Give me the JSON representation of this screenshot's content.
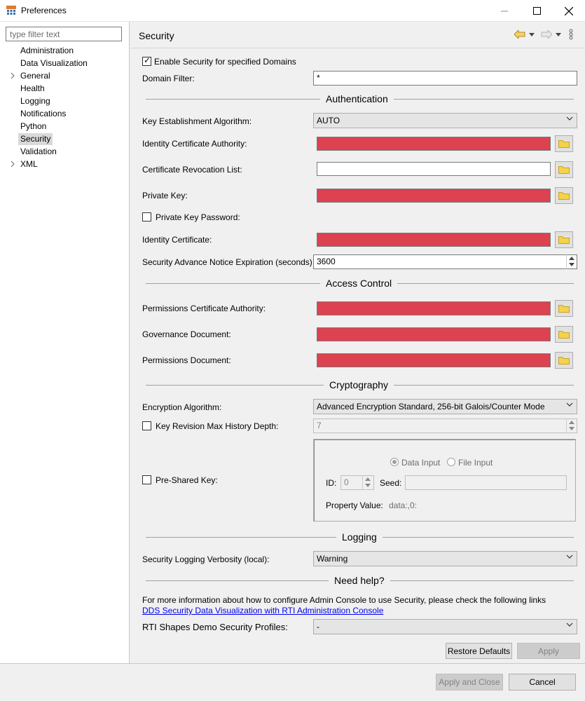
{
  "window": {
    "title": "Preferences",
    "minimize": "—",
    "maximize": "☐",
    "close": "✕"
  },
  "sidebar": {
    "filter_placeholder": "type filter text",
    "items": [
      {
        "label": "Administration",
        "expandable": false
      },
      {
        "label": "Data Visualization",
        "expandable": false
      },
      {
        "label": "General",
        "expandable": true
      },
      {
        "label": "Health",
        "expandable": false
      },
      {
        "label": "Logging",
        "expandable": false
      },
      {
        "label": "Notifications",
        "expandable": false
      },
      {
        "label": "Python",
        "expandable": false
      },
      {
        "label": "Security",
        "expandable": false,
        "selected": true
      },
      {
        "label": "Validation",
        "expandable": false
      },
      {
        "label": "XML",
        "expandable": true
      }
    ]
  },
  "page": {
    "title": "Security",
    "enable_security_label": "Enable Security for specified Domains",
    "enable_security_checked": true,
    "domain_filter_label": "Domain Filter:",
    "domain_filter_value": "*"
  },
  "authentication": {
    "title": "Authentication",
    "key_establishment_label": "Key Establishment Algorithm:",
    "key_establishment_value": "AUTO",
    "identity_ca_label": "Identity Certificate Authority:",
    "crl_label": "Certificate Revocation List:",
    "private_key_label": "Private Key:",
    "private_key_password_label": "Private Key Password:",
    "identity_cert_label": "Identity Certificate:",
    "advance_notice_label": "Security Advance Notice Expiration (seconds)",
    "advance_notice_value": "3600"
  },
  "access_control": {
    "title": "Access Control",
    "permissions_ca_label": "Permissions Certificate Authority:",
    "governance_label": "Governance Document:",
    "permissions_doc_label": "Permissions Document:"
  },
  "cryptography": {
    "title": "Cryptography",
    "encryption_label": "Encryption Algorithm:",
    "encryption_value": "Advanced Encryption Standard, 256-bit Galois/Counter Mode",
    "key_revision_label": "Key Revision Max History Depth:",
    "key_revision_value": "7",
    "pre_shared_label": "Pre-Shared Key:",
    "data_input_label": "Data Input",
    "file_input_label": "File Input",
    "id_label": "ID:",
    "id_value": "0",
    "seed_label": "Seed:",
    "property_value_label": "Property Value:",
    "property_value": "data:,0:"
  },
  "logging": {
    "title": "Logging",
    "verbosity_label": "Security Logging Verbosity (local):",
    "verbosity_value": "Warning"
  },
  "help": {
    "title": "Need help?",
    "text": "For more information about how to configure Admin Console to use Security, please check the following links",
    "link": "DDS Security Data Visualization with RTI Administration Console",
    "shapes_label": "RTI Shapes Demo Security Profiles:",
    "shapes_value": "-"
  },
  "buttons": {
    "restore_defaults": "Restore Defaults",
    "apply": "Apply",
    "apply_and_close": "Apply and Close",
    "cancel": "Cancel"
  },
  "colors": {
    "error_field": "#dc4250",
    "folder_icon": "#f5d24b",
    "link": "#0000ee"
  }
}
